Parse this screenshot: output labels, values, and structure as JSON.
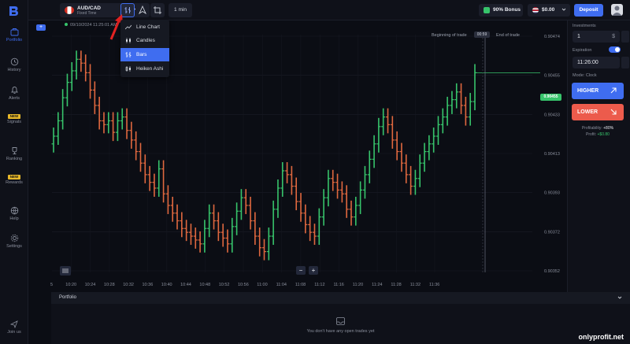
{
  "sidebar": {
    "items": [
      {
        "label": "Portfolio",
        "icon": "briefcase-icon",
        "active": true
      },
      {
        "label": "History",
        "icon": "history-icon"
      },
      {
        "label": "Alerts",
        "icon": "bell-icon"
      },
      {
        "label": "Signals",
        "icon": "signals-icon",
        "badge": "NEW"
      },
      {
        "label": "Ranking",
        "icon": "trophy-icon"
      },
      {
        "label": "Rewards",
        "icon": "gift-icon",
        "badge": "NEW"
      },
      {
        "label": "Help",
        "icon": "help-icon"
      },
      {
        "label": "Settings",
        "icon": "gear-icon"
      }
    ],
    "join_label": "Join us"
  },
  "topbar": {
    "asset_name": "AUD/CAD",
    "asset_sub": "Fixed Time",
    "timeframe": "1 min",
    "bonus": "90% Bonus",
    "balance": "$0.00",
    "deposit": "Deposit"
  },
  "chart": {
    "clock": "09/10/2024 11:25:01 AM",
    "beginning_label": "Beginning of trade",
    "end_label": "End of trade",
    "timer": "00:59",
    "current_price": "0.90455",
    "plus_label": "+",
    "zoom_out": "−",
    "zoom_in": "+"
  },
  "dropdown": {
    "items": [
      {
        "label": "Line Chart",
        "icon": "line-chart-icon"
      },
      {
        "label": "Candles",
        "icon": "candles-icon"
      },
      {
        "label": "Bars",
        "icon": "bars-icon",
        "selected": true
      },
      {
        "label": "Heiken Ashi",
        "icon": "heiken-ashi-icon"
      }
    ]
  },
  "right_panel": {
    "investment_label": "Investments",
    "investment_value": "1",
    "investment_suffix": "$",
    "expiration_label": "Expiration",
    "expiration_value": "11:26:00",
    "mode_label": "Mode: Clock",
    "higher": "HIGHER",
    "lower": "LOWER",
    "profitability_label": "Profitability:",
    "profitability_value": "+80%",
    "profit_label": "Profit:",
    "profit_value": "+$0.80"
  },
  "portfolio": {
    "title": "Portfolio",
    "empty_text": "You don't have any open trades yet"
  },
  "watermark": "onlyprofit.net",
  "colors": {
    "up": "#37c46b",
    "down": "#e0683f",
    "accent": "#3f6df0",
    "lower": "#ec5b4c"
  },
  "chart_data": {
    "type": "bar",
    "y_ticks": [
      "0.90474",
      "0.90455",
      "0.90433",
      "0.90413",
      "0.90393",
      "0.90372",
      "0.90352"
    ],
    "x_ticks": [
      "5",
      "10:20",
      "10:24",
      "10:28",
      "10:32",
      "10:36",
      "10:40",
      "10:44",
      "10:48",
      "10:52",
      "10:56",
      "11:00",
      "11:04",
      "11:08",
      "11:12",
      "11:16",
      "11:20",
      "11:24",
      "11:28",
      "11:32",
      "11:36"
    ],
    "ylim": [
      0.90352,
      0.90474
    ],
    "closes": [
      0.90422,
      0.9043,
      0.90442,
      0.9045,
      0.90456,
      0.90462,
      0.9046,
      0.90455,
      0.90446,
      0.90438,
      0.9043,
      0.90428,
      0.9043,
      0.90424,
      0.9043,
      0.90432,
      0.90425,
      0.9042,
      0.90414,
      0.90408,
      0.90402,
      0.90398,
      0.90395,
      0.90405,
      0.90392,
      0.90386,
      0.90382,
      0.90378,
      0.90374,
      0.90372,
      0.9037,
      0.90368,
      0.90366,
      0.90374,
      0.90382,
      0.90378,
      0.90372,
      0.90369,
      0.90366,
      0.90375,
      0.90383,
      0.9039,
      0.90386,
      0.90378,
      0.9037,
      0.90364,
      0.90362,
      0.9037,
      0.90384,
      0.90395,
      0.90404,
      0.90402,
      0.90396,
      0.90388,
      0.90382,
      0.90376,
      0.90372,
      0.9037,
      0.9038,
      0.9039,
      0.904,
      0.90398,
      0.90394,
      0.90392,
      0.90384,
      0.9038,
      0.90386,
      0.90394,
      0.90402,
      0.9041,
      0.90418,
      0.90427,
      0.90432,
      0.90428,
      0.9042,
      0.90414,
      0.90408,
      0.90402,
      0.90396,
      0.904,
      0.90408,
      0.90414,
      0.90418,
      0.90422,
      0.90428,
      0.90432,
      0.90438,
      0.90441,
      0.90445,
      0.90438,
      0.90432,
      0.9044,
      0.90455
    ]
  }
}
